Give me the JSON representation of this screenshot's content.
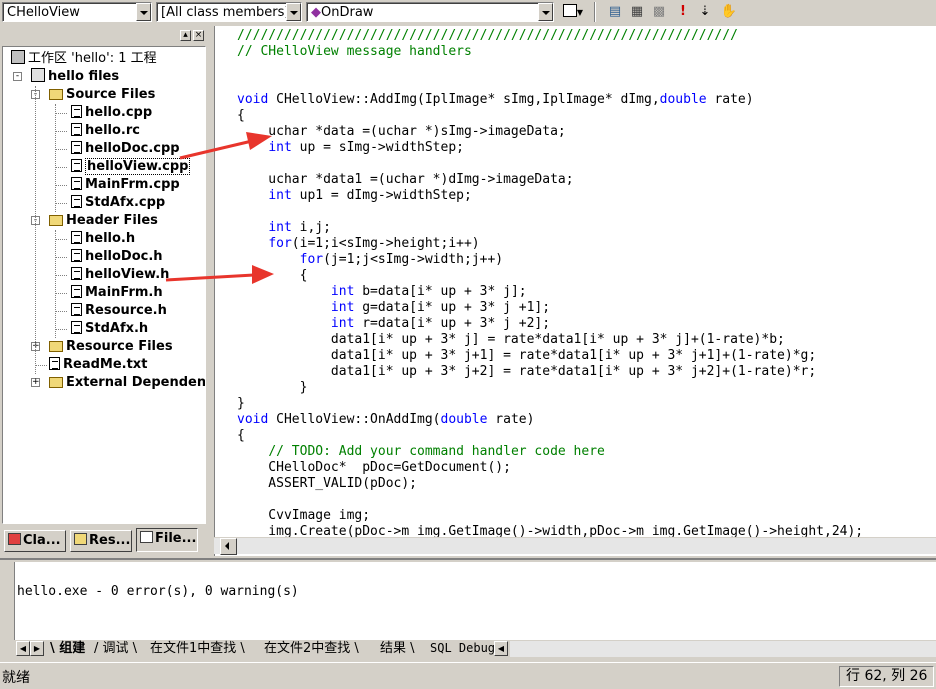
{
  "toolbar": {
    "class_combo": "CHelloView",
    "filter_combo": "[All class members]",
    "member_combo": "OnDraw",
    "member_icon": "purple-diamond-icon",
    "buttons": [
      "wizard-icon",
      "class-wizard-icon",
      "build-icon",
      "stop-build-icon",
      "execute-icon",
      "step-into-icon",
      "breakpoint-hand-icon"
    ]
  },
  "workspace": {
    "close_glyph": "×",
    "tree": [
      {
        "label": "工作区 'hello': 1 工程",
        "kind": "workspace",
        "level": 0
      },
      {
        "label": "hello files",
        "kind": "project",
        "level": 0,
        "expander": "-"
      },
      {
        "label": "Source Files",
        "kind": "folder",
        "level": 1,
        "expander": "-"
      },
      {
        "label": "hello.cpp",
        "kind": "file",
        "level": 2
      },
      {
        "label": "hello.rc",
        "kind": "file",
        "level": 2
      },
      {
        "label": "helloDoc.cpp",
        "kind": "file",
        "level": 2
      },
      {
        "label": "helloView.cpp",
        "kind": "file",
        "level": 2,
        "selected": true
      },
      {
        "label": "MainFrm.cpp",
        "kind": "file",
        "level": 2
      },
      {
        "label": "StdAfx.cpp",
        "kind": "file",
        "level": 2
      },
      {
        "label": "Header Files",
        "kind": "folder",
        "level": 1,
        "expander": "-"
      },
      {
        "label": "hello.h",
        "kind": "file",
        "level": 2
      },
      {
        "label": "helloDoc.h",
        "kind": "file",
        "level": 2
      },
      {
        "label": "helloView.h",
        "kind": "file",
        "level": 2
      },
      {
        "label": "MainFrm.h",
        "kind": "file",
        "level": 2
      },
      {
        "label": "Resource.h",
        "kind": "file",
        "level": 2
      },
      {
        "label": "StdAfx.h",
        "kind": "file",
        "level": 2
      },
      {
        "label": "Resource Files",
        "kind": "folder",
        "level": 1,
        "expander": "+"
      },
      {
        "label": "ReadMe.txt",
        "kind": "file",
        "level": 1
      },
      {
        "label": "External Dependenc",
        "kind": "folder",
        "level": 1,
        "expander": "+"
      }
    ],
    "tabs": [
      {
        "label": "Cla...",
        "icon": "class-view-icon"
      },
      {
        "label": "Res...",
        "icon": "resource-view-icon"
      },
      {
        "label": "File...",
        "icon": "file-view-icon"
      }
    ]
  },
  "editor": {
    "lines": [
      [
        {
          "t": "////////////////////////////////////////////////////////////////",
          "c": "cm"
        }
      ],
      [
        {
          "t": "// CHelloView message handlers",
          "c": "cm"
        }
      ],
      [],
      [],
      [
        {
          "t": "void",
          "c": "kw"
        },
        {
          "t": " CHelloView::AddImg(IplImage* sImg,IplImage* dImg,"
        },
        {
          "t": "double",
          "c": "kw"
        },
        {
          "t": " rate)"
        }
      ],
      [
        {
          "t": "{"
        }
      ],
      [
        {
          "t": "    uchar *data =(uchar *)sImg->imageData;"
        }
      ],
      [
        {
          "t": "    "
        },
        {
          "t": "int",
          "c": "kw"
        },
        {
          "t": " up = sImg->widthStep;"
        }
      ],
      [],
      [
        {
          "t": "    uchar *data1 =(uchar *)dImg->imageData;"
        }
      ],
      [
        {
          "t": "    "
        },
        {
          "t": "int",
          "c": "kw"
        },
        {
          "t": " up1 = dImg->widthStep;"
        }
      ],
      [],
      [
        {
          "t": "    "
        },
        {
          "t": "int",
          "c": "kw"
        },
        {
          "t": " i,j;"
        }
      ],
      [
        {
          "t": "    "
        },
        {
          "t": "for",
          "c": "kw"
        },
        {
          "t": "(i=1;i<sImg->height;i++)"
        }
      ],
      [
        {
          "t": "        "
        },
        {
          "t": "for",
          "c": "kw"
        },
        {
          "t": "(j=1;j<sImg->width;j++)"
        }
      ],
      [
        {
          "t": "        {"
        }
      ],
      [
        {
          "t": "            "
        },
        {
          "t": "int",
          "c": "kw"
        },
        {
          "t": " b=data[i* up + 3* j];"
        }
      ],
      [
        {
          "t": "            "
        },
        {
          "t": "int",
          "c": "kw"
        },
        {
          "t": " g=data[i* up + 3* j +1];"
        }
      ],
      [
        {
          "t": "            "
        },
        {
          "t": "int",
          "c": "kw"
        },
        {
          "t": " r=data[i* up + 3* j +2];"
        }
      ],
      [
        {
          "t": "            data1[i* up + 3* j] = rate*data1[i* up + 3* j]+(1-rate)*b;"
        }
      ],
      [
        {
          "t": "            data1[i* up + 3* j+1] = rate*data1[i* up + 3* j+1]+(1-rate)*g;"
        }
      ],
      [
        {
          "t": "            data1[i* up + 3* j+2] = rate*data1[i* up + 3* j+2]+(1-rate)*r;"
        }
      ],
      [
        {
          "t": "        }"
        }
      ],
      [
        {
          "t": "}"
        }
      ],
      [
        {
          "t": "void",
          "c": "kw"
        },
        {
          "t": " CHelloView::OnAddImg("
        },
        {
          "t": "double",
          "c": "kw"
        },
        {
          "t": " rate)"
        }
      ],
      [
        {
          "t": "{"
        }
      ],
      [
        {
          "t": "    "
        },
        {
          "t": "// TODO: Add your command handler code here",
          "c": "cm"
        }
      ],
      [
        {
          "t": "    CHelloDoc*  pDoc=GetDocument();"
        }
      ],
      [
        {
          "t": "    ASSERT_VALID(pDoc);"
        }
      ],
      [],
      [
        {
          "t": "    CvvImage img;"
        }
      ],
      [
        {
          "t": "    img.Create(pDoc->m img.GetImage()->width,pDoc->m img.GetImage()->height,24);"
        }
      ]
    ]
  },
  "output": {
    "text": "hello.exe - 0 error(s), 0 warning(s)",
    "tabs": [
      "组建",
      "调试",
      "在文件1中查找",
      "在文件2中查找",
      "结果",
      "SQL Debug"
    ]
  },
  "status": {
    "left": "就绪",
    "right": "行 62, 列 26"
  },
  "colors": {
    "keyword": "#0000ff",
    "comment": "#008000",
    "arrow": "#e8352c"
  }
}
